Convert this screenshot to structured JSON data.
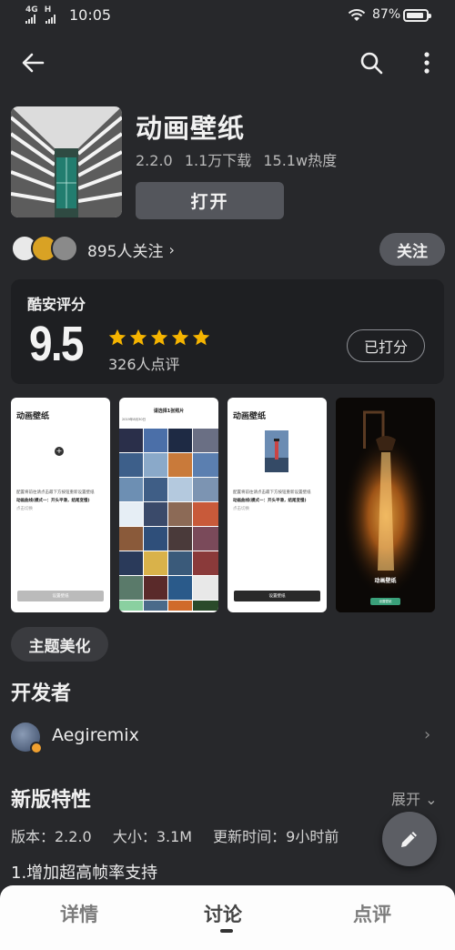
{
  "status_bar": {
    "network": "4G",
    "network2": "H",
    "time": "10:05",
    "battery": "87%",
    "battery_level": 0.87
  },
  "toolbar": {
    "back_icon": "arrow-left-icon",
    "search_icon": "search-icon",
    "more_icon": "more-vertical-icon"
  },
  "app": {
    "name": "动画壁纸",
    "version": "2.2.0",
    "downloads": "1.1万下载",
    "heat": "15.1w热度",
    "open_label": "打开"
  },
  "followers": {
    "label": "895人关注",
    "chevron": "›",
    "follow_label": "关注"
  },
  "rating": {
    "title": "酷安评分",
    "score": "9.5",
    "stars": 5,
    "count_label": "326人点评",
    "rated_label": "已打分"
  },
  "screenshots": [
    {
      "title": "动画壁纸",
      "caption1": "配置将前往请点击最下方按钮重新设置壁纸",
      "caption2": "动画曲线(模式一：开头平滑，结尾变慢)",
      "caption3": "点击切换",
      "button": "设置壁纸"
    },
    {
      "title": "请选择1张照片",
      "date": "2019年8月30日"
    },
    {
      "title": "动画壁纸",
      "caption1": "配置将前往请点击最下方按钮重新设置壁纸",
      "caption2": "动画曲线(模式一：开头平滑，结尾变慢)",
      "caption3": "点击切换",
      "button": "设置壁纸"
    },
    {
      "title": "动画壁纸",
      "button": "设置壁纸"
    }
  ],
  "tag": "主题美化",
  "developer": {
    "heading": "开发者",
    "name": "Aegiremix",
    "chevron": "›"
  },
  "version_info": {
    "heading": "新版特性",
    "expand_label": "展开 ⌄",
    "version": "版本：2.2.0",
    "size": "大小：3.1M",
    "updated": "更新时间：9小时前",
    "note": "1.增加超高帧率支持"
  },
  "fab_icon": "pencil-icon",
  "tabs": [
    {
      "label": "详情"
    },
    {
      "label": "讨论"
    },
    {
      "label": "点评"
    }
  ],
  "colors": {
    "background": "#27282b",
    "card": "#1e1f22",
    "button": "#54565c",
    "star": "#f5b400"
  }
}
